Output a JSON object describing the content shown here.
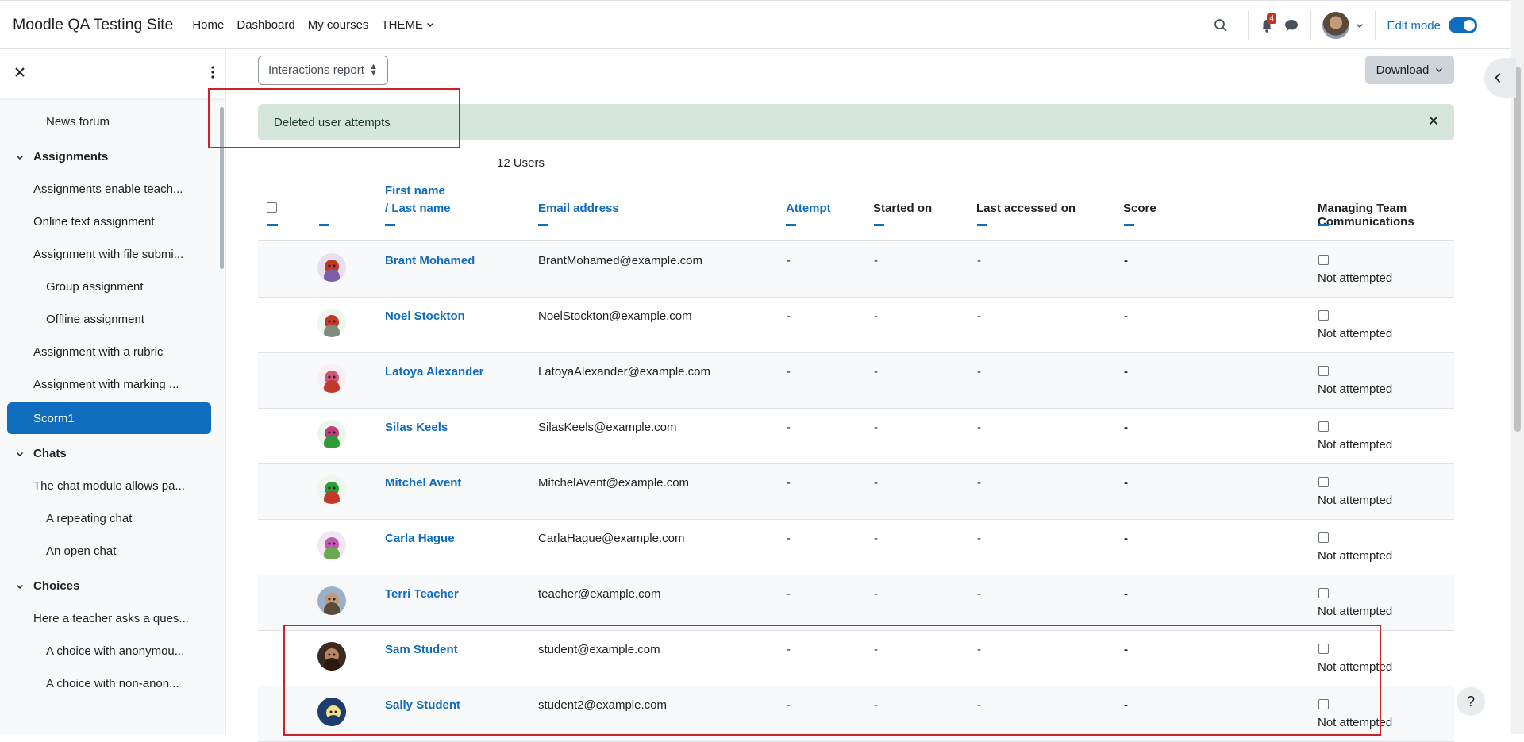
{
  "nav": {
    "site_name": "Moodle QA Testing Site",
    "links": [
      "Home",
      "Dashboard",
      "My courses",
      "THEME"
    ],
    "notification_count": "4",
    "edit_mode_label": "Edit mode"
  },
  "drawer": {
    "items": [
      {
        "label": "News forum",
        "kind": "sub"
      },
      {
        "label": "Assignments",
        "kind": "section"
      },
      {
        "label": "Assignments enable teach...",
        "kind": "item"
      },
      {
        "label": "Online text assignment",
        "kind": "item"
      },
      {
        "label": "Assignment with file submi...",
        "kind": "item"
      },
      {
        "label": "Group assignment",
        "kind": "sub"
      },
      {
        "label": "Offline assignment",
        "kind": "sub"
      },
      {
        "label": "Assignment with a rubric",
        "kind": "item"
      },
      {
        "label": "Assignment with marking ...",
        "kind": "item"
      },
      {
        "label": "Scorm1",
        "kind": "active"
      },
      {
        "label": "Chats",
        "kind": "section"
      },
      {
        "label": "The chat module allows pa...",
        "kind": "item"
      },
      {
        "label": "A repeating chat",
        "kind": "sub"
      },
      {
        "label": "An open chat",
        "kind": "sub"
      },
      {
        "label": "Choices",
        "kind": "section"
      },
      {
        "label": "Here a teacher asks a ques...",
        "kind": "item"
      },
      {
        "label": "A choice with anonymou...",
        "kind": "sub"
      },
      {
        "label": "A choice with non-anon...",
        "kind": "sub"
      }
    ]
  },
  "main": {
    "report_select": "Interactions report",
    "download_label": "Download",
    "alert_text": "Deleted user attempts",
    "users_count": "12 Users",
    "headers": {
      "first_name": "First name",
      "last_name": "/ Last name",
      "email": "Email address",
      "attempt": "Attempt",
      "started_on": "Started on",
      "last_accessed": "Last accessed on",
      "score": "Score",
      "interaction": "Managing Team Communications"
    },
    "rows": [
      {
        "name": "Brant Mohamed",
        "email": "BrantMohamed@example.com",
        "attempt": "-",
        "started": "-",
        "accessed": "-",
        "score": "-",
        "status": "Not attempted"
      },
      {
        "name": "Noel Stockton",
        "email": "NoelStockton@example.com",
        "attempt": "-",
        "started": "-",
        "accessed": "-",
        "score": "-",
        "status": "Not attempted"
      },
      {
        "name": "Latoya Alexander",
        "email": "LatoyaAlexander@example.com",
        "attempt": "-",
        "started": "-",
        "accessed": "-",
        "score": "-",
        "status": "Not attempted"
      },
      {
        "name": "Silas Keels",
        "email": "SilasKeels@example.com",
        "attempt": "-",
        "started": "-",
        "accessed": "-",
        "score": "-",
        "status": "Not attempted"
      },
      {
        "name": "Mitchel Avent",
        "email": "MitchelAvent@example.com",
        "attempt": "-",
        "started": "-",
        "accessed": "-",
        "score": "-",
        "status": "Not attempted"
      },
      {
        "name": "Carla Hague",
        "email": "CarlaHague@example.com",
        "attempt": "-",
        "started": "-",
        "accessed": "-",
        "score": "-",
        "status": "Not attempted"
      },
      {
        "name": "Terri Teacher",
        "email": "teacher@example.com",
        "attempt": "-",
        "started": "-",
        "accessed": "-",
        "score": "-",
        "status": "Not attempted"
      },
      {
        "name": "Sam Student",
        "email": "student@example.com",
        "attempt": "-",
        "started": "-",
        "accessed": "-",
        "score": "-",
        "status": "Not attempted"
      },
      {
        "name": "Sally Student",
        "email": "student2@example.com",
        "attempt": "-",
        "started": "-",
        "accessed": "-",
        "score": "-",
        "status": "Not attempted"
      }
    ]
  },
  "colors": {
    "primary": "#0f6cbf",
    "alert_bg": "#d7e6da",
    "highlight": "#d32027"
  }
}
